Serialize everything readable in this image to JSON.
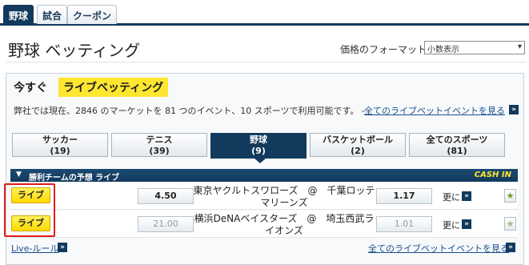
{
  "tabs": [
    {
      "label": "野球",
      "active": true
    },
    {
      "label": "試合",
      "active": false
    },
    {
      "label": "クーポン",
      "active": false
    }
  ],
  "header": {
    "title": "野球 ベッティング",
    "format_label": "価格のフォーマット：",
    "format_value": "小数表示"
  },
  "live": {
    "lead": "今すぐ",
    "badge": "ライブベッティング",
    "info": "弊社では現在、2846 のマーケットを 81 つのイベント、10 スポーツで利用可能です。 -",
    "all_link": "全てのライブベットイベントを見る"
  },
  "sports": [
    {
      "name": "サッカー",
      "count": "(19)",
      "active": false
    },
    {
      "name": "テニス",
      "count": "(39)",
      "active": false
    },
    {
      "name": "野球",
      "count": "(9)",
      "active": true
    },
    {
      "name": "バスケットボール",
      "count": "(2)",
      "active": false
    },
    {
      "name": "全てのスポーツ",
      "count": "(81)",
      "active": false
    }
  ],
  "market": {
    "title": "勝利チームの予想 ライブ",
    "cash_in": "CASH IN"
  },
  "matches": [
    {
      "live_label": "ライブ",
      "home_odds": "4.50",
      "home_odds_dim": false,
      "teams": "東京ヤクルトスワローズ　@　千葉ロッテマリーンズ",
      "away_odds": "1.17",
      "away_odds_dim": false,
      "more": "更に"
    },
    {
      "live_label": "ライブ",
      "home_odds": "21.00",
      "home_odds_dim": true,
      "teams": "横浜DeNAベイスターズ　@　埼玉西武ライオンズ",
      "away_odds": "1.01",
      "away_odds_dim": true,
      "more": "更に"
    }
  ],
  "footer": {
    "rules_link": "Live-ルール",
    "all_link": "全てのライブベットイベントを見る"
  },
  "colors": {
    "navy": "#123a5c",
    "live_yellow": "#ffe631",
    "highlight_red": "#e01b1b",
    "link_blue": "#1a4f8c"
  },
  "icons": [
    "double-chevron-right-icon",
    "star-icon",
    "triangle-down-icon",
    "dropdown-arrow-icon"
  ]
}
